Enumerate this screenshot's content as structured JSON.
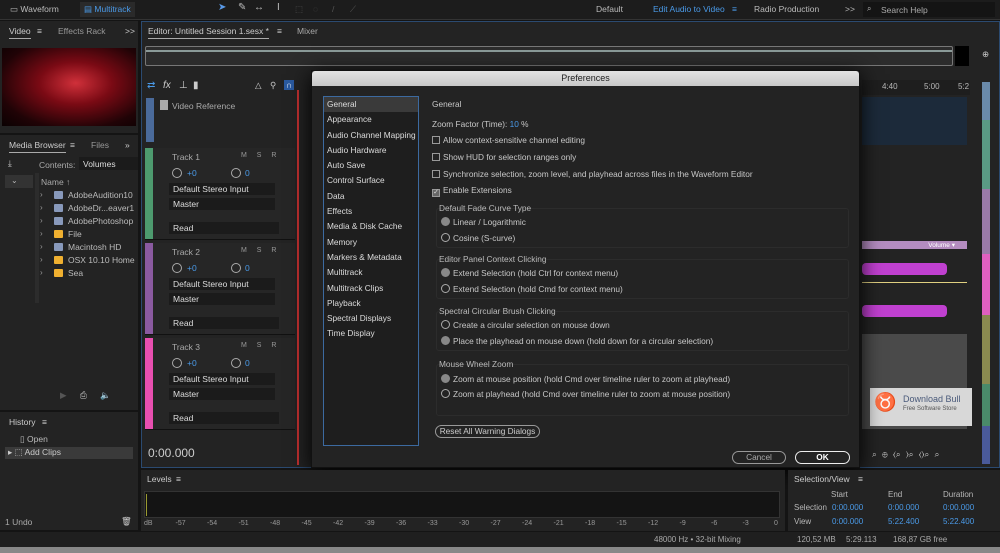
{
  "topbar": {
    "waveform": "Waveform",
    "multitrack": "Multitrack",
    "workspaces": [
      "Default",
      "Edit Audio to Video",
      "Radio Production"
    ],
    "more": ">>",
    "search_placeholder": "Search Help"
  },
  "video_panel": {
    "tabs": [
      "Video",
      "Effects Rack"
    ],
    "more": ">>"
  },
  "media_browser": {
    "tabs": [
      "Media Browser",
      "Files"
    ],
    "contents_label": "Contents:",
    "contents_value": "Volumes",
    "name_header": "Name ↑",
    "items": [
      "AdobeAudition10",
      "AdobeDr...eaver1",
      "AdobePhotoshop",
      "File",
      "Macintosh HD",
      "OSX 10.10 Home",
      "Sea"
    ]
  },
  "history": {
    "title": "History",
    "items": [
      "Open",
      "Add Clips"
    ],
    "undo_count": "1 Undo"
  },
  "editor": {
    "tab": "Editor: Untitled Session 1.sesx *",
    "mixer_tab": "Mixer",
    "video_reference": "Video Reference",
    "time": "0:00.000",
    "ruler": [
      "4:40",
      "5:00",
      "5:2"
    ],
    "volume_label": "Volume",
    "tracks": [
      {
        "name": "Track 1",
        "color": "#4d9a6e",
        "vol": "+0",
        "pan": "0",
        "input": "Default Stereo Input",
        "output": "Master",
        "mode": "Read"
      },
      {
        "name": "Track 2",
        "color": "#8a5aa0",
        "vol": "+0",
        "pan": "0",
        "input": "Default Stereo Input",
        "output": "Master",
        "mode": "Read"
      },
      {
        "name": "Track 3",
        "color": "#e84fb0",
        "vol": "+0",
        "pan": "0",
        "input": "Default Stereo Input",
        "output": "Master",
        "mode": "Read"
      }
    ],
    "msr": "M S R"
  },
  "preferences": {
    "title": "Preferences",
    "categories": [
      "General",
      "Appearance",
      "Audio Channel Mapping",
      "Audio Hardware",
      "Auto Save",
      "Control Surface",
      "Data",
      "Effects",
      "Media & Disk Cache",
      "Memory",
      "Markers & Metadata",
      "Multitrack",
      "Multitrack Clips",
      "Playback",
      "Spectral Displays",
      "Time Display"
    ],
    "section": "General",
    "zoom_label": "Zoom Factor (Time):",
    "zoom_value": "10",
    "zoom_unit": "%",
    "checkboxes": [
      {
        "label": "Allow context-sensitive channel editing",
        "checked": false
      },
      {
        "label": "Show HUD for selection ranges only",
        "checked": false
      },
      {
        "label": "Synchronize selection, zoom level, and playhead across files in the Waveform Editor",
        "checked": false
      },
      {
        "label": "Enable Extensions",
        "checked": true
      }
    ],
    "groups": [
      {
        "title": "Default Fade Curve Type",
        "options": [
          "Linear / Logarithmic",
          "Cosine (S-curve)"
        ],
        "selected": 0
      },
      {
        "title": "Editor Panel Context Clicking",
        "options": [
          "Extend Selection (hold Ctrl for context menu)",
          "Extend Selection (hold Cmd for context menu)"
        ],
        "selected": 0
      },
      {
        "title": "Spectral Circular Brush Clicking",
        "options": [
          "Create a circular selection on mouse down",
          "Place the playhead on mouse down (hold down for a circular selection)"
        ],
        "selected": 1
      },
      {
        "title": "Mouse Wheel Zoom",
        "options": [
          "Zoom at mouse position (hold Cmd over timeline ruler to zoom at playhead)",
          "Zoom at playhead (hold Cmd over timeline ruler to zoom at mouse position)"
        ],
        "selected": 0
      }
    ],
    "reset_button": "Reset All Warning Dialogs",
    "cancel": "Cancel",
    "ok": "OK"
  },
  "levels": {
    "title": "Levels",
    "ticks": [
      "dB",
      "-57",
      "-54",
      "-51",
      "-48",
      "-45",
      "-42",
      "-39",
      "-36",
      "-33",
      "-30",
      "-27",
      "-24",
      "-21",
      "-18",
      "-15",
      "-12",
      "-9",
      "-6",
      "-3",
      "0"
    ]
  },
  "selection_view": {
    "title": "Selection/View",
    "headers": [
      "Start",
      "End",
      "Duration"
    ],
    "rows": [
      {
        "label": "Selection",
        "values": [
          "0:00.000",
          "0:00.000",
          "0:00.000"
        ]
      },
      {
        "label": "View",
        "values": [
          "0:00.000",
          "5:22.400",
          "5:22.400"
        ]
      }
    ]
  },
  "status": {
    "format": "48000 Hz • 32-bit Mixing",
    "memory": "120,52 MB",
    "duration": "5:29.113",
    "free": "168,87 GB free"
  },
  "watermark": {
    "title": "Download Bull",
    "subtitle": "Free Software Store"
  }
}
